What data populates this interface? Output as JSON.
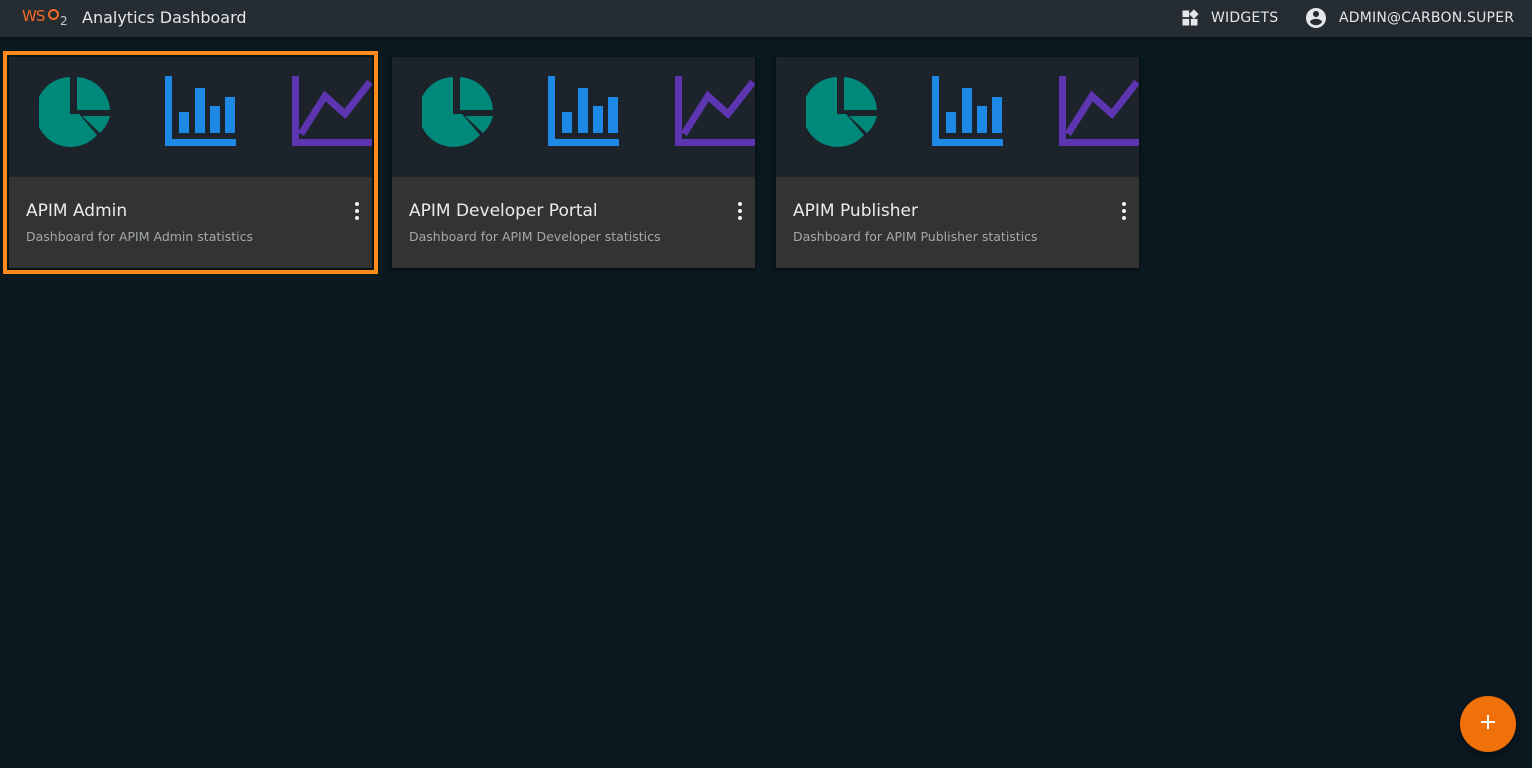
{
  "header": {
    "logo_text": "WSO2",
    "logo_ws": "WS",
    "logo_two": "2",
    "title": "Analytics Dashboard",
    "widgets_label": "WIDGETS",
    "widgets_icon": "widgets-icon",
    "user_label": "ADMIN@CARBON.SUPER",
    "user_icon": "account-circle-icon"
  },
  "colors": {
    "topbar": "#252c32",
    "background": "#0a1820",
    "accent": "#f0700a",
    "selection": "#ff8a1a",
    "pie": "#00897b",
    "bar": "#1e88e5",
    "line": "#5e35b1"
  },
  "dashboards": [
    {
      "name": "APIM Admin",
      "description": "Dashboard for APIM Admin statistics",
      "selected": true,
      "menu_icon": "more-vert-icon"
    },
    {
      "name": "APIM Developer Portal",
      "description": "Dashboard for APIM Developer statistics",
      "selected": false,
      "menu_icon": "more-vert-icon"
    },
    {
      "name": "APIM Publisher",
      "description": "Dashboard for APIM Publisher statistics",
      "selected": false,
      "menu_icon": "more-vert-icon"
    }
  ],
  "fab": {
    "icon": "add-icon"
  }
}
